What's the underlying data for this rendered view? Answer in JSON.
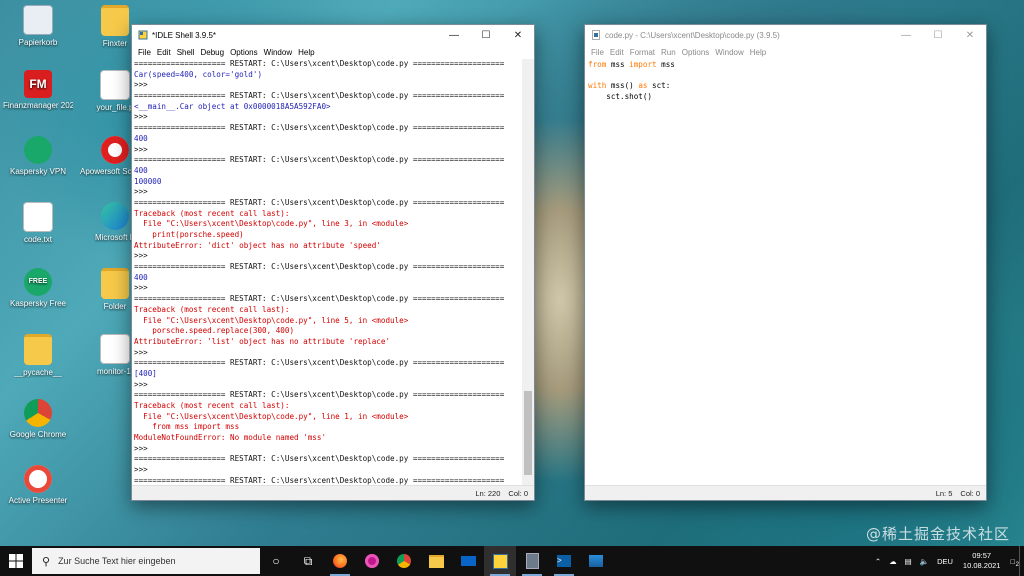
{
  "desktop": {
    "icons": [
      {
        "label": "Papierkorb",
        "icon": "recycle-bin-icon"
      },
      {
        "label": "Finanzmanager 2020",
        "icon": "finanzmanager-icon",
        "glyph": "FM"
      },
      {
        "label": "Kaspersky VPN",
        "icon": "kaspersky-vpn-icon"
      },
      {
        "label": "code.txt",
        "icon": "text-file-icon"
      },
      {
        "label": "Kaspersky Free",
        "icon": "kaspersky-free-icon",
        "glyph": "FREE"
      },
      {
        "label": "__pycache__",
        "icon": "folder-icon"
      },
      {
        "label": "Google Chrome",
        "icon": "chrome-icon"
      },
      {
        "label": "Active Presenter",
        "icon": "active-presenter-icon"
      },
      {
        "label": "Finxter",
        "icon": "folder-icon"
      },
      {
        "label": "your_file.p",
        "icon": "python-file-icon"
      },
      {
        "label": "Apowersoft Screen Reco",
        "icon": "apowersoft-icon"
      },
      {
        "label": "Microsoft E",
        "icon": "edge-icon"
      },
      {
        "label": "Folder",
        "icon": "folder-icon"
      },
      {
        "label": "monitor-1.",
        "icon": "image-file-icon"
      }
    ]
  },
  "shell_window": {
    "title": "*IDLE Shell 3.9.5*",
    "menu": [
      "File",
      "Edit",
      "Shell",
      "Debug",
      "Options",
      "Window",
      "Help"
    ],
    "status": {
      "ln": "Ln: 220",
      "col": "Col: 0"
    },
    "lines": [
      {
        "text": "==================== RESTART: C:\\Users\\xcent\\Desktop\\code.py ====================",
        "color": "black"
      },
      {
        "text": "Car(speed=400, color='gold')",
        "color": "blue"
      },
      {
        "text": ">>>",
        "color": "black"
      },
      {
        "text": "==================== RESTART: C:\\Users\\xcent\\Desktop\\code.py ====================",
        "color": "black"
      },
      {
        "text": "<__main__.Car object at 0x0000018A5A592FA0>",
        "color": "blue"
      },
      {
        "text": ">>>",
        "color": "black"
      },
      {
        "text": "==================== RESTART: C:\\Users\\xcent\\Desktop\\code.py ====================",
        "color": "black"
      },
      {
        "text": "400",
        "color": "blue"
      },
      {
        "text": ">>>",
        "color": "black"
      },
      {
        "text": "==================== RESTART: C:\\Users\\xcent\\Desktop\\code.py ====================",
        "color": "black"
      },
      {
        "text": "400",
        "color": "blue"
      },
      {
        "text": "100000",
        "color": "blue"
      },
      {
        "text": ">>>",
        "color": "black"
      },
      {
        "text": "==================== RESTART: C:\\Users\\xcent\\Desktop\\code.py ====================",
        "color": "black"
      },
      {
        "text": "Traceback (most recent call last):",
        "color": "red"
      },
      {
        "text": "  File \"C:\\Users\\xcent\\Desktop\\code.py\", line 3, in <module>",
        "color": "red"
      },
      {
        "text": "    print(porsche.speed)",
        "color": "red"
      },
      {
        "text": "AttributeError: 'dict' object has no attribute 'speed'",
        "color": "red"
      },
      {
        "text": ">>>",
        "color": "black"
      },
      {
        "text": "==================== RESTART: C:\\Users\\xcent\\Desktop\\code.py ====================",
        "color": "black"
      },
      {
        "text": "400",
        "color": "blue"
      },
      {
        "text": ">>>",
        "color": "black"
      },
      {
        "text": "==================== RESTART: C:\\Users\\xcent\\Desktop\\code.py ====================",
        "color": "black"
      },
      {
        "text": "Traceback (most recent call last):",
        "color": "red"
      },
      {
        "text": "  File \"C:\\Users\\xcent\\Desktop\\code.py\", line 5, in <module>",
        "color": "red"
      },
      {
        "text": "    porsche.speed.replace(300, 400)",
        "color": "red"
      },
      {
        "text": "AttributeError: 'list' object has no attribute 'replace'",
        "color": "red"
      },
      {
        "text": ">>>",
        "color": "black"
      },
      {
        "text": "==================== RESTART: C:\\Users\\xcent\\Desktop\\code.py ====================",
        "color": "black"
      },
      {
        "text": "[400]",
        "color": "blue"
      },
      {
        "text": ">>>",
        "color": "black"
      },
      {
        "text": "==================== RESTART: C:\\Users\\xcent\\Desktop\\code.py ====================",
        "color": "black"
      },
      {
        "text": "Traceback (most recent call last):",
        "color": "red"
      },
      {
        "text": "  File \"C:\\Users\\xcent\\Desktop\\code.py\", line 1, in <module>",
        "color": "red"
      },
      {
        "text": "    from mss import mss",
        "color": "red"
      },
      {
        "text": "ModuleNotFoundError: No module named 'mss'",
        "color": "red"
      },
      {
        "text": ">>>",
        "color": "black"
      },
      {
        "text": "==================== RESTART: C:\\Users\\xcent\\Desktop\\code.py ====================",
        "color": "black"
      },
      {
        "text": ">>>",
        "color": "black"
      },
      {
        "text": "==================== RESTART: C:\\Users\\xcent\\Desktop\\code.py ====================",
        "color": "black"
      }
    ]
  },
  "editor_window": {
    "title": "code.py - C:\\Users\\xcent\\Desktop\\code.py (3.9.5)",
    "menu": [
      "File",
      "Edit",
      "Format",
      "Run",
      "Options",
      "Window",
      "Help"
    ],
    "status": {
      "ln": "Ln: 5",
      "col": "Col: 0"
    },
    "lines": [
      [
        {
          "t": "from",
          "k": true
        },
        {
          "t": " mss ",
          "k": false
        },
        {
          "t": "import",
          "k": true
        },
        {
          "t": " mss",
          "k": false
        }
      ],
      [],
      [
        {
          "t": "with",
          "k": true
        },
        {
          "t": " mss() ",
          "k": false
        },
        {
          "t": "as",
          "k": true
        },
        {
          "t": " sct:",
          "k": false
        }
      ],
      [
        {
          "t": "    sct.shot()",
          "k": false
        }
      ]
    ]
  },
  "taskbar": {
    "search_placeholder": "Zur Suche Text hier eingeben",
    "language": "DEU",
    "time": "09:57",
    "date": "10.08.2021",
    "notification_count": "2"
  },
  "watermark": "@稀土掘金技术社区",
  "colors": {
    "keyword": "#ff7700",
    "output": "#1e1eb4",
    "error": "#d20000"
  }
}
